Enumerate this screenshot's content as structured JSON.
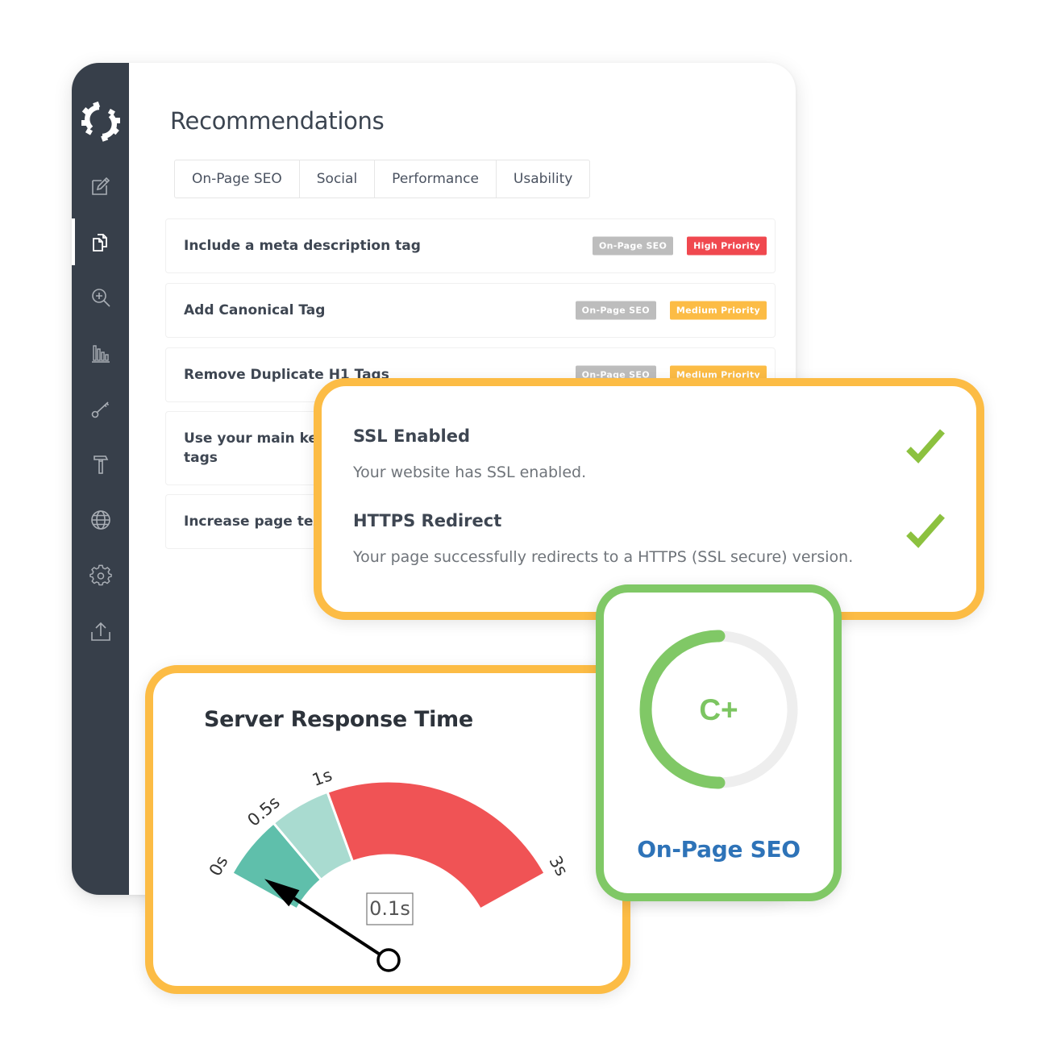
{
  "sidebar": {
    "logo": "gears-logo",
    "items": [
      {
        "icon": "edit-icon",
        "label": "Edit"
      },
      {
        "icon": "documents-icon",
        "label": "Documents",
        "active": true
      },
      {
        "icon": "zoom-in-icon",
        "label": "Search"
      },
      {
        "icon": "bar-chart-icon",
        "label": "Reports"
      },
      {
        "icon": "key-icon",
        "label": "Keywords"
      },
      {
        "icon": "hammer-icon",
        "label": "Tools"
      },
      {
        "icon": "globe-icon",
        "label": "Web"
      },
      {
        "icon": "gear-icon",
        "label": "Settings"
      },
      {
        "icon": "upload-icon",
        "label": "Export"
      }
    ]
  },
  "main": {
    "title": "Recommendations",
    "tabs": [
      {
        "label": "On-Page SEO"
      },
      {
        "label": "Social"
      },
      {
        "label": "Performance"
      },
      {
        "label": "Usability"
      }
    ],
    "recommendations": [
      {
        "title": "Include a meta description tag",
        "category": "On-Page SEO",
        "priority": "High Priority",
        "priority_level": "high"
      },
      {
        "title": "Add Canonical Tag",
        "category": "On-Page SEO",
        "priority": "Medium Priority",
        "priority_level": "medium"
      },
      {
        "title": "Remove Duplicate H1 Tags",
        "category": "On-Page SEO",
        "priority": "Medium Priority",
        "priority_level": "medium"
      },
      {
        "title": "Use your main keywords across the important HTML tags",
        "visible_title": "Use your main keyw",
        "visible_second_line": "tags"
      },
      {
        "title": "Increase page text content",
        "visible_title": "Increase page text c"
      }
    ]
  },
  "ssl_card": {
    "items": [
      {
        "title": "SSL Enabled",
        "description": "Your website has SSL enabled.",
        "status": "pass"
      },
      {
        "title": "HTTPS Redirect",
        "description": "Your page successfully redirects to a HTTPS (SSL secure) version.",
        "status": "pass"
      }
    ]
  },
  "server_response": {
    "title": "Server Response Time",
    "value": 0.1,
    "value_label": "0.1s"
  },
  "score_card": {
    "grade": "C+",
    "label": "On-Page SEO",
    "progress": 0.5
  },
  "colors": {
    "accent_orange": "#fcbc45",
    "accent_green": "#80c866",
    "high_priority": "#f0484f",
    "medium_priority": "#fcbc45",
    "category_badge": "#bdbdbd",
    "gauge_good": "#5fbfab",
    "gauge_ok": "#a9dbd0",
    "gauge_bad": "#f05355",
    "check_green": "#8cc13f",
    "score_track": "#eeeeee",
    "label_blue": "#2e73b8"
  },
  "chart_data": {
    "type": "gauge",
    "title": "Server Response Time",
    "unit": "s",
    "value": 0.1,
    "value_label": "0.1s",
    "range": [
      0,
      3
    ],
    "ticks": [
      {
        "value": 0,
        "label": "0s"
      },
      {
        "value": 0.5,
        "label": "0.5s"
      },
      {
        "value": 1,
        "label": "1s"
      },
      {
        "value": 3,
        "label": "3s"
      }
    ],
    "bands": [
      {
        "from": 0,
        "to": 0.5,
        "status": "good"
      },
      {
        "from": 0.5,
        "to": 1,
        "status": "ok"
      },
      {
        "from": 1,
        "to": 3,
        "status": "bad"
      }
    ]
  }
}
